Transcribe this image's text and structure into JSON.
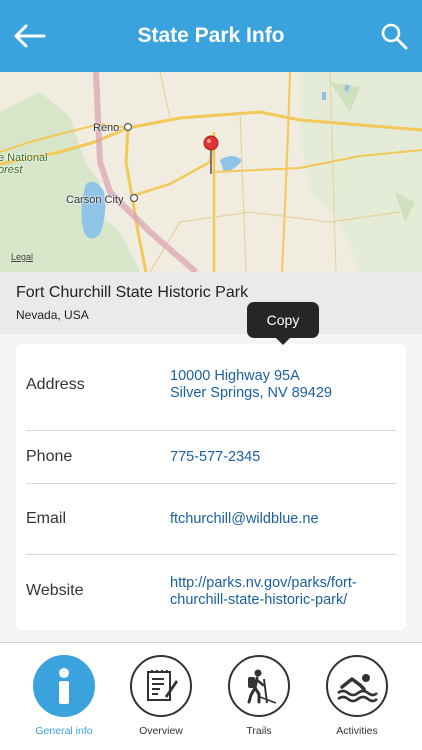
{
  "header": {
    "title": "State Park Info",
    "back_icon": "back-arrow-icon",
    "search_icon": "search-icon",
    "bar_color": "#3aa3dd"
  },
  "map": {
    "labels": {
      "reno": "Reno",
      "carson_city": "Carson City",
      "national_forest_line1": "e National",
      "national_forest_line2": "orest"
    },
    "legal": "Legal",
    "pin_icon": "map-pin-icon"
  },
  "park": {
    "name": "Fort Churchill State Historic Park",
    "region": "Nevada, USA"
  },
  "tooltip": {
    "label": "Copy"
  },
  "info": {
    "address_label": "Address",
    "address_line1": "10000 Highway 95A",
    "address_line2": "Silver Springs, NV 89429",
    "phone_label": "Phone",
    "phone_value": "775-577-2345",
    "email_label": "Email",
    "email_value": "ftchurchill@wildblue.ne",
    "website_label": "Website",
    "website_line1": "http://parks.nv.gov/parks/fort-",
    "website_line2": "churchill-state-historic-park/",
    "link_color": "#1a5f9f"
  },
  "tabs": [
    {
      "label": "General info",
      "icon": "info-icon",
      "active": true
    },
    {
      "label": "Overview",
      "icon": "overview-icon",
      "active": false
    },
    {
      "label": "Trails",
      "icon": "hiker-icon",
      "active": false
    },
    {
      "label": "Activities",
      "icon": "swimmer-icon",
      "active": false
    }
  ]
}
